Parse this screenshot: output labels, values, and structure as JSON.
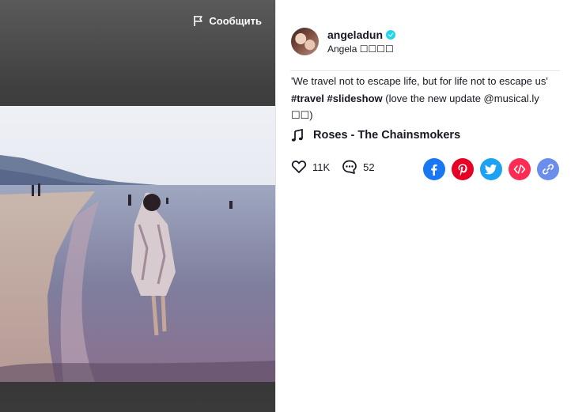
{
  "video": {
    "report_label": "Сообщить"
  },
  "author": {
    "username": "angeladun",
    "nickname": "Angela ☐☐☐☐"
  },
  "caption": {
    "text_before": "'We travel not to escape life, but for life not to escape us' ",
    "tag1": "#travel",
    "tag2": "#slideshow",
    "text_after": " (love the new update @musical.ly ☐☐)"
  },
  "music": {
    "title": "Roses - The Chainsmokers"
  },
  "stats": {
    "likes": "11K",
    "comments": "52"
  },
  "share": {
    "colors": {
      "facebook": "#1877f2",
      "pinterest": "#e60023",
      "twitter": "#1da1f2",
      "embed": "#fe2c55",
      "link": "#6b8eed"
    }
  },
  "icons": [
    "flag-icon",
    "verified-icon",
    "music-note-icon",
    "heart-icon",
    "comment-icon",
    "facebook-icon",
    "pinterest-icon",
    "twitter-icon",
    "embed-icon",
    "link-icon"
  ]
}
